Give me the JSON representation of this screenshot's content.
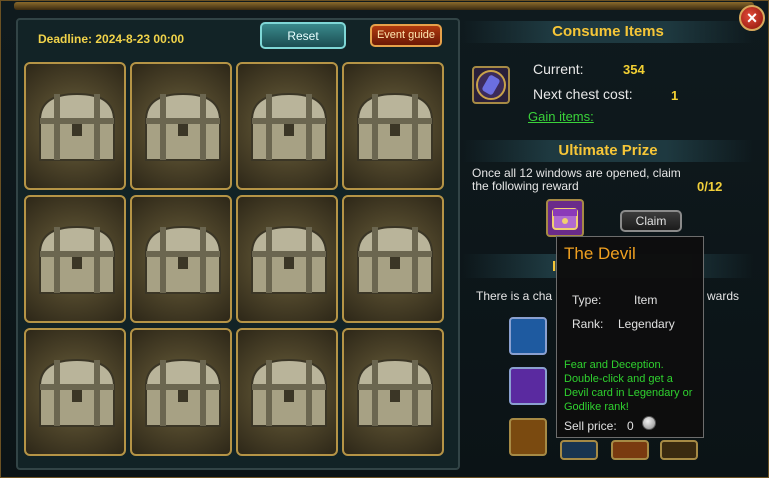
{
  "header": {
    "deadline": "Deadline: 2024-8-23 00:00",
    "reset_label": "Reset",
    "guide_label": "Event guide"
  },
  "chests": {
    "count": 12
  },
  "consume": {
    "title": "Consume Items",
    "current_label": "Current:",
    "current_value": "354",
    "next_cost_label": "Next chest cost:",
    "next_cost_value": "1",
    "gain_link": "Gain items:"
  },
  "ultimate": {
    "title": "Ultimate Prize",
    "description": "Once all 12 windows are opened, claim the following reward",
    "progress": "0/12",
    "claim_label": "Claim"
  },
  "rewards": {
    "title_fragment": "I",
    "text_left": "There is a cha",
    "text_right": "wards"
  },
  "tooltip": {
    "name": "The Devil",
    "type_label": "Type:",
    "type_value": "Item",
    "rank_label": "Rank:",
    "rank_value": "Legendary",
    "description": "Fear and Deception. Double-click and get a Devil card in Legendary or Godlike rank!",
    "sell_label": "Sell price:",
    "sell_value": "0"
  },
  "colors": {
    "gold": "#f6c637",
    "green": "#2fd12f",
    "tooltip_title": "#f0a020"
  },
  "icons": [
    "close-icon",
    "treasure-chest-icon",
    "crystal-item-icon",
    "devil-card-icon",
    "silver-coin-icon"
  ]
}
